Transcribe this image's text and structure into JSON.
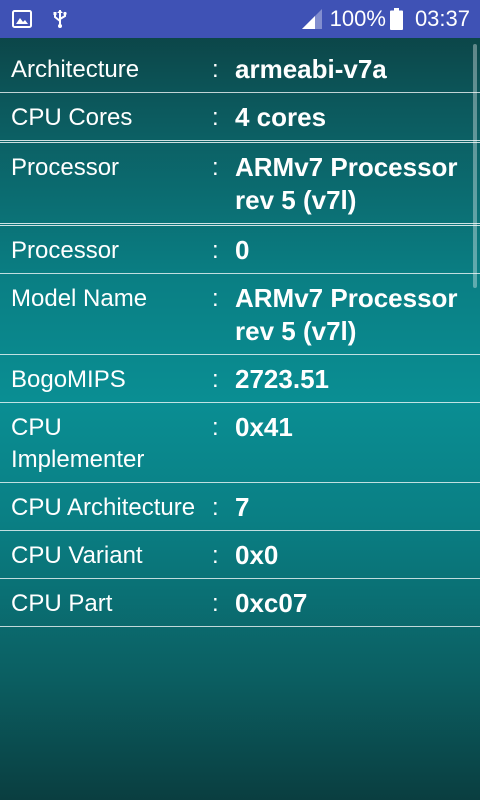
{
  "status_bar": {
    "battery_percent": "100%",
    "time": "03:37",
    "icons": [
      "image-icon",
      "usb-icon",
      "signal-icon",
      "battery-icon"
    ]
  },
  "rows": [
    {
      "label": "Architecture",
      "separator": ":",
      "value": "armeabi-v7a"
    },
    {
      "label": "CPU Cores",
      "separator": ":",
      "value": "4 cores"
    },
    {
      "label": "Processor",
      "separator": ":",
      "value": "ARMv7 Processor rev 5 (v7l)"
    },
    {
      "label": "Processor",
      "separator": ":",
      "value": "0"
    },
    {
      "label": "Model Name",
      "separator": ":",
      "value": "ARMv7 Processor rev 5 (v7l)"
    },
    {
      "label": "BogoMIPS",
      "separator": ":",
      "value": "2723.51"
    },
    {
      "label": "CPU Implementer",
      "separator": ":",
      "value": "0x41"
    },
    {
      "label": "CPU Architecture",
      "separator": ":",
      "value": "7"
    },
    {
      "label": "CPU Variant",
      "separator": ":",
      "value": "0x0"
    },
    {
      "label": "CPU Part",
      "separator": ":",
      "value": "0xc07"
    }
  ],
  "colors": {
    "status_bar": "#3f52b5",
    "text": "#ffffff"
  }
}
